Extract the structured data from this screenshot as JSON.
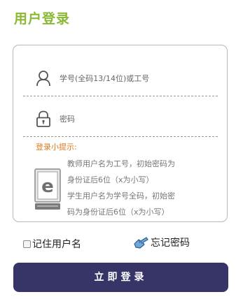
{
  "header": {
    "title": "用户登录"
  },
  "form": {
    "username": {
      "placeholder": "学号(全码13/14位)或工号",
      "icon": "user-icon"
    },
    "password": {
      "placeholder": "密码",
      "icon": "lock-icon"
    },
    "hint": {
      "title": "登录小提示:",
      "icon": "document-e-icon",
      "lines": [
        "教师用户名为工号，初始密码为",
        "身份证后6位（x为小写）",
        "学生用户名为学号全码，初始密",
        "码为身份证后6位（x为小写）"
      ]
    }
  },
  "options": {
    "remember_label": "记住用户名",
    "forgot_label": "忘记密码",
    "forgot_icon": "hand-pointer-icon"
  },
  "actions": {
    "login_label": "立即登录"
  },
  "colors": {
    "title": "#8ab833",
    "hint_title": "#e07a1f",
    "button": "#373568",
    "border": "#b8b8b8"
  }
}
